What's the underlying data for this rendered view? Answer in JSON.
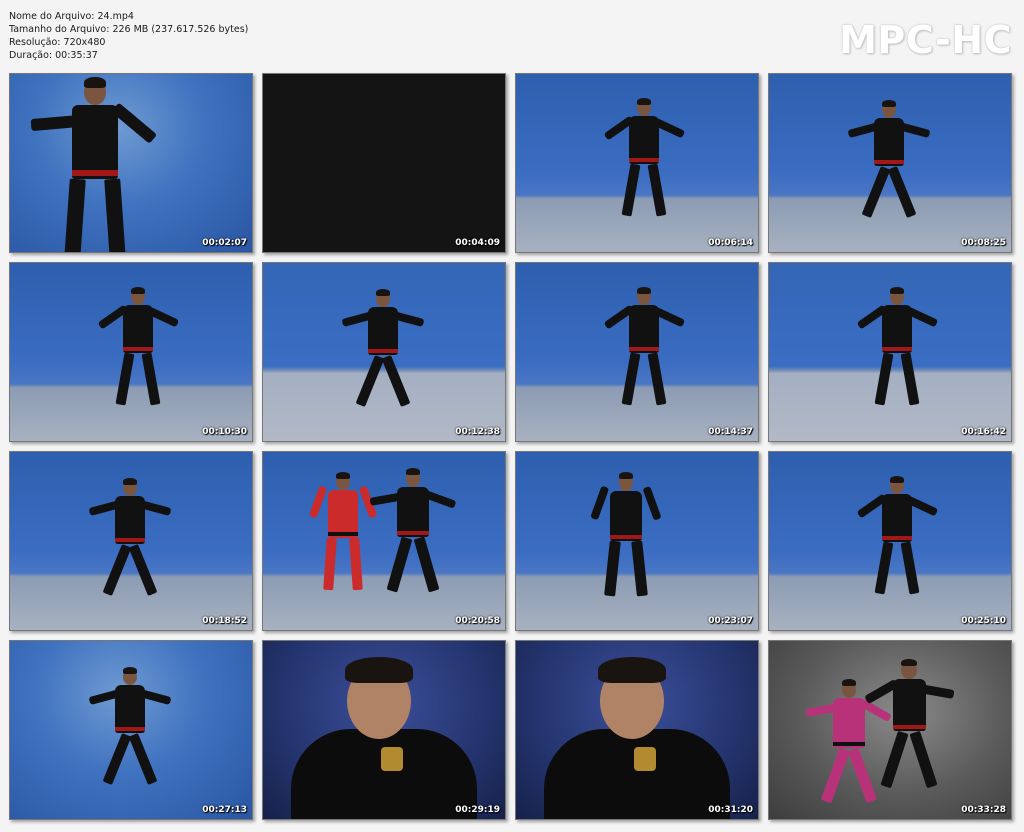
{
  "file_info": {
    "name": "Nome do Arquivo: 24.mp4",
    "size": "Tamanho do Arquivo: 226 MB (237.617.526 bytes)",
    "resolution": "Resolução: 720x480",
    "duration": "Duração: 00:35:37"
  },
  "logo": "MPC-HC",
  "thumbnails": [
    {
      "time": "00:02:07",
      "scene": "bg-studio",
      "kind": "close-left"
    },
    {
      "time": "00:04:09",
      "scene": "bg-dark",
      "kind": "none"
    },
    {
      "time": "00:06:14",
      "scene": "bg-blue",
      "kind": "stand"
    },
    {
      "time": "00:08:25",
      "scene": "bg-blue",
      "kind": "wide"
    },
    {
      "time": "00:10:30",
      "scene": "bg-blue",
      "kind": "stand"
    },
    {
      "time": "00:12:38",
      "scene": "bg-blue2",
      "kind": "wide"
    },
    {
      "time": "00:14:37",
      "scene": "bg-blue",
      "kind": "stand"
    },
    {
      "time": "00:16:42",
      "scene": "bg-blue2",
      "kind": "stand"
    },
    {
      "time": "00:18:52",
      "scene": "bg-blue",
      "kind": "wide"
    },
    {
      "time": "00:20:58",
      "scene": "bg-blue",
      "kind": "two"
    },
    {
      "time": "00:23:07",
      "scene": "bg-blue",
      "kind": "front"
    },
    {
      "time": "00:25:10",
      "scene": "bg-blue",
      "kind": "stand"
    },
    {
      "time": "00:27:13",
      "scene": "bg-studio",
      "kind": "wide"
    },
    {
      "time": "00:29:19",
      "scene": "bg-portrait",
      "kind": "portrait"
    },
    {
      "time": "00:31:20",
      "scene": "bg-portrait",
      "kind": "portrait"
    },
    {
      "time": "00:33:28",
      "scene": "bg-gray",
      "kind": "two-gray"
    }
  ]
}
